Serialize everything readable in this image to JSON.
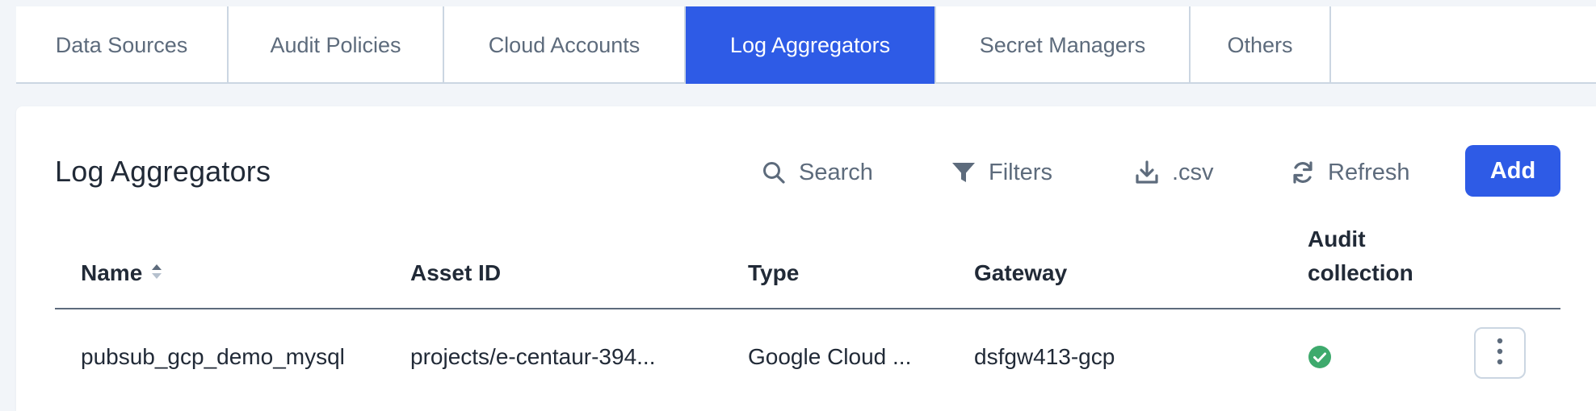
{
  "tabs": [
    {
      "label": "Data Sources",
      "active": false
    },
    {
      "label": "Audit Policies",
      "active": false
    },
    {
      "label": "Cloud Accounts",
      "active": false
    },
    {
      "label": "Log Aggregators",
      "active": true
    },
    {
      "label": "Secret Managers",
      "active": false
    },
    {
      "label": "Others",
      "active": false
    }
  ],
  "panel": {
    "title": "Log Aggregators"
  },
  "toolbar": {
    "search_label": "Search",
    "search_icon": "search-icon",
    "filters_label": "Filters",
    "filters_icon": "filter-icon",
    "csv_label": ".csv",
    "csv_icon": "download-icon",
    "refresh_label": "Refresh",
    "refresh_icon": "refresh-icon",
    "add_label": "Add"
  },
  "table": {
    "columns": {
      "name": "Name",
      "asset_id": "Asset ID",
      "type": "Type",
      "gateway": "Gateway",
      "audit_line1": "Audit",
      "audit_line2": "collection"
    },
    "rows": [
      {
        "name": "pubsub_gcp_demo_mysql",
        "asset_id": "projects/e-centaur-394...",
        "type": "Google Cloud ...",
        "gateway": "dsfgw413-gcp",
        "audit_collection": "enabled",
        "status_icon": "check-circle-icon",
        "actions_icon": "more-vertical-icon"
      }
    ]
  },
  "colors": {
    "accent": "#2e5be6",
    "success": "#3eaa6d",
    "text": "#212a37",
    "muted": "#5d6b7c",
    "border": "#cbd6e2",
    "background": "#f2f5f9"
  }
}
